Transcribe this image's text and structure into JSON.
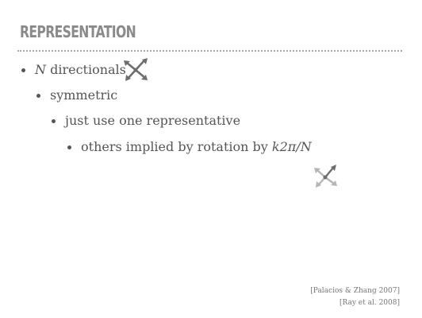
{
  "slide": {
    "title": "REPRESENTATION",
    "bullets": [
      {
        "level": 1,
        "var": "N",
        "text": " directionals"
      },
      {
        "level": 2,
        "text": "symmetric"
      },
      {
        "level": 3,
        "text": "just use one representative"
      },
      {
        "level": 4,
        "text": "others implied by rotation by ",
        "math": "k2π/N"
      }
    ],
    "references": [
      "[Palacios & Zhang 2007]",
      "[Ray et al. 2008]"
    ],
    "icons": {
      "directionals": "four-arrows-icon",
      "representative": "four-arrows-highlighted-icon"
    },
    "colors": {
      "title": "#8a8a8a",
      "text": "#555555",
      "icon_dark": "#6e6e6e",
      "icon_light": "#b5b5b5"
    }
  }
}
